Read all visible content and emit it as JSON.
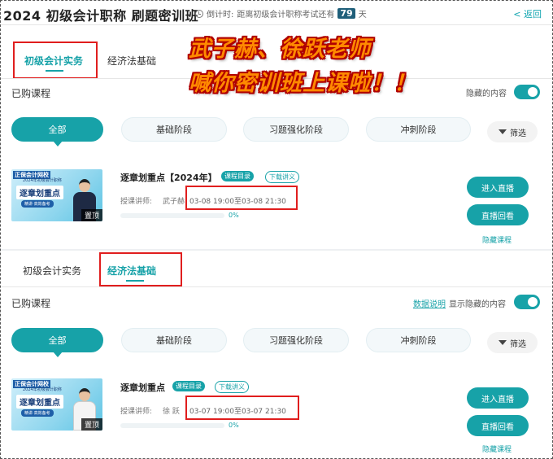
{
  "header": {
    "title": "2024 初级会计职称 刷题密训班",
    "countdown_prefix": "倒计时:",
    "countdown_text": "距离初级会计职称考试还有",
    "days": "79",
    "days_unit": "天",
    "back": "< 返回"
  },
  "overlay": {
    "line1": "武子赫、徐跃老师",
    "line2": "喊你密训班上课啦！！"
  },
  "section1": {
    "tabs": [
      "初级会计实务",
      "经济法基础"
    ],
    "purchased": "已购课程",
    "hidden_label_partial": "隐藏的内容",
    "stages": [
      "全部",
      "基础阶段",
      "习题强化阶段",
      "冲刺阶段"
    ],
    "filter": "筛选",
    "course": {
      "title": "逐章划重点【2024年】",
      "tag_catalog": "课程目录",
      "tag_download": "下载讲义",
      "teacher_label": "授课讲师:",
      "teacher_name": "武子赫",
      "time": "03-08 19:00至03-08 21:30",
      "progress": "0%",
      "thumb_brand": "正保会计网校",
      "thumb_sub": "2024年初级会计职称",
      "thumb_big": "逐章划重点",
      "thumb_pill": "精讲·高效备考",
      "thumb_pin": "置顶",
      "btn_live": "进入直播",
      "btn_replay": "直播回看",
      "hide": "隐藏课程"
    }
  },
  "section2": {
    "tabs": [
      "初级会计实务",
      "经济法基础"
    ],
    "purchased": "已购课程",
    "data_desc": "数据说明",
    "show_hidden": "显示隐藏的内容",
    "stages": [
      "全部",
      "基础阶段",
      "习题强化阶段",
      "冲刺阶段"
    ],
    "filter": "筛选",
    "course": {
      "title": "逐章划重点",
      "tag_catalog": "课程目录",
      "tag_download": "下载讲义",
      "teacher_label": "授课讲师:",
      "teacher_name": "徐 跃",
      "time": "03-07 19:00至03-07 21:30",
      "progress": "0%",
      "thumb_brand": "正保会计网校",
      "thumb_sub": "2024年初级会计职称",
      "thumb_big": "逐章划重点",
      "thumb_pill": "精讲·高效备考",
      "thumb_pin": "置顶",
      "btn_live": "进入直播",
      "btn_replay": "直播回看",
      "hide": "隐藏课程"
    }
  },
  "colors": {
    "accent": "#17a2a8",
    "annotation_red": "#e01e1e",
    "overlay_orange": "#ff8a00"
  }
}
